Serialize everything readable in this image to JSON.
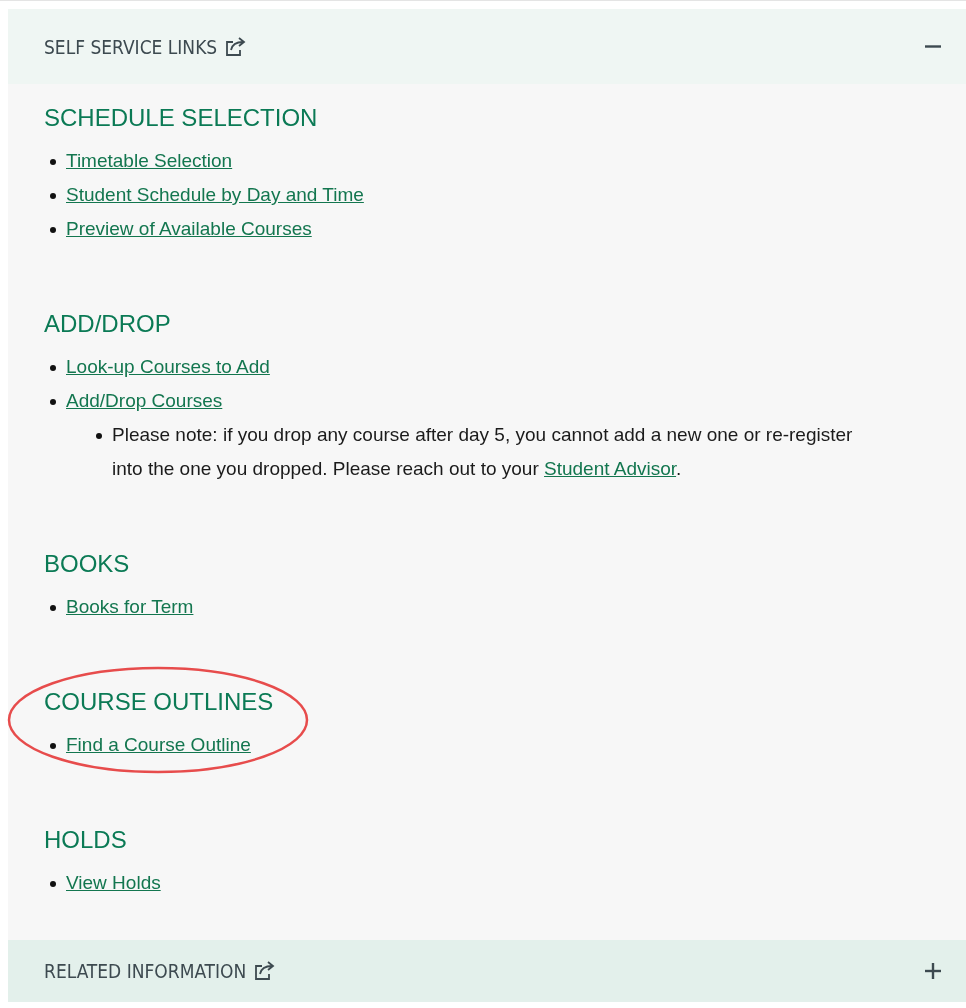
{
  "panels": [
    {
      "title": "SELF SERVICE LINKS",
      "expanded": true,
      "sections": [
        {
          "heading": "SCHEDULE SELECTION",
          "circled": false,
          "links": [
            {
              "label": "Timetable Selection"
            },
            {
              "label": "Student Schedule by Day and Time"
            },
            {
              "label": "Preview of Available Courses"
            }
          ]
        },
        {
          "heading": "ADD/DROP",
          "circled": false,
          "links": [
            {
              "label": "Look-up Courses to Add"
            },
            {
              "label": "Add/Drop Courses",
              "notes": [
                {
                  "text": "Please note: if you drop any course after day 5, you cannot add a new one or re-register into the one you dropped. Please reach out to your ",
                  "link": "Student Advisor",
                  "after": "."
                }
              ]
            }
          ]
        },
        {
          "heading": "BOOKS",
          "circled": false,
          "links": [
            {
              "label": "Books for Term"
            }
          ]
        },
        {
          "heading": "COURSE OUTLINES",
          "circled": true,
          "links": [
            {
              "label": "Find a Course Outline"
            }
          ]
        },
        {
          "heading": "HOLDS",
          "circled": false,
          "links": [
            {
              "label": "View Holds"
            }
          ]
        }
      ]
    },
    {
      "title": "RELATED INFORMATION",
      "expanded": false
    }
  ]
}
